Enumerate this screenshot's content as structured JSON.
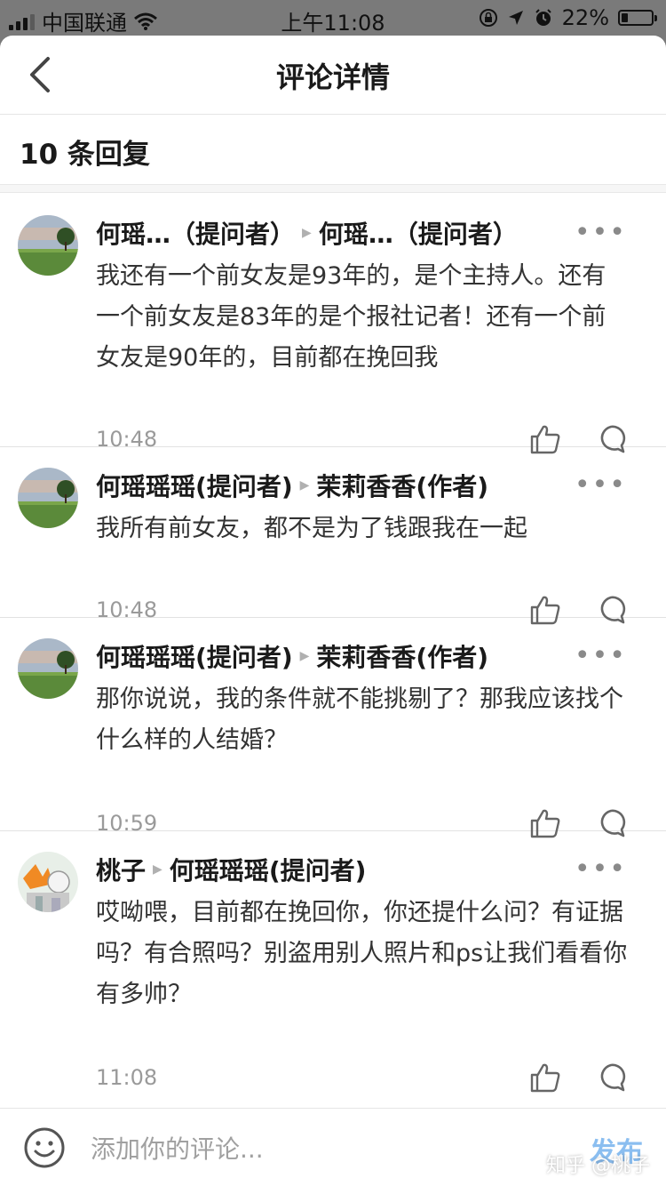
{
  "status_bar": {
    "carrier": "中国联通",
    "time": "上午11:08",
    "battery": "22%",
    "battery_level": 0.22
  },
  "header": {
    "title": "评论详情",
    "reply_count": "10 条回复"
  },
  "comments": [
    {
      "author": "何瑶…",
      "author_role": "（提问者）",
      "reply_to": "何瑶…",
      "reply_to_role": "（提问者）",
      "text": "我还有一个前女友是93年的，是个主持人。还有一个前女友是83年的是个报社记者！还有一个前女友是90年的，目前都在挽回我",
      "time": "10:48"
    },
    {
      "author": "何瑶瑶瑶",
      "author_role": "(提问者)",
      "reply_to": "茉莉香香",
      "reply_to_role": "(作者)",
      "text": "我所有前女友，都不是为了钱跟我在一起",
      "time": "10:48"
    },
    {
      "author": "何瑶瑶瑶",
      "author_role": "(提问者)",
      "reply_to": "茉莉香香",
      "reply_to_role": "(作者)",
      "text": "那你说说，我的条件就不能挑剔了？那我应该找个什么样的人结婚？",
      "time": "10:59"
    },
    {
      "author": "桃子",
      "author_role": "",
      "reply_to": "何瑶瑶瑶",
      "reply_to_role": "(提问者)",
      "text": "哎呦喂，目前都在挽回你，你还提什么问？有证据吗？有合照吗？别盗用别人照片和ps让我们看看你有多帅？",
      "time": "11:08"
    }
  ],
  "more_label": "•••",
  "input_bar": {
    "placeholder": "添加你的评论...",
    "publish": "发布",
    "watermark": "知乎 @桃子"
  },
  "icons": {
    "back": "chevron-left-icon",
    "like": "thumbs-up-icon",
    "reply": "comment-bubble-icon",
    "emoji": "smiley-icon",
    "more": "ellipsis-icon"
  },
  "colors": {
    "publish": "#8bbef0",
    "time_text": "#9a9a9a",
    "status_bar_bg": "#7a7a7a"
  }
}
